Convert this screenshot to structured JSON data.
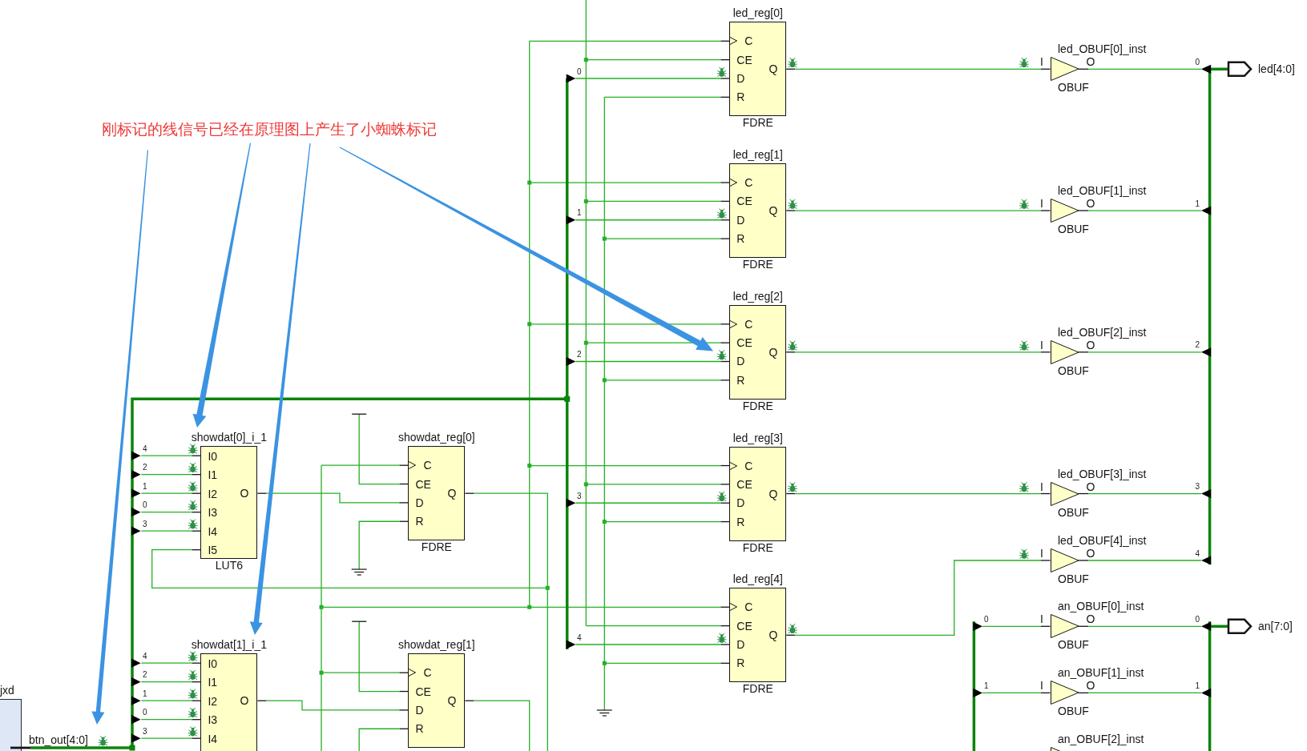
{
  "annotation": {
    "text": "刚标记的线信号已经在原理图上产生了小蜘蛛标记"
  },
  "source_module": {
    "name": "jxd",
    "output": {
      "label": "btn_out[4:0]",
      "debug": true
    }
  },
  "luts": [
    {
      "name": "showdat[0]_i_1",
      "type": "LUT6",
      "inputs": [
        {
          "label": "I0",
          "bit": "4",
          "debug": true
        },
        {
          "label": "I1",
          "bit": "2",
          "debug": true
        },
        {
          "label": "I2",
          "bit": "1",
          "debug": true
        },
        {
          "label": "I3",
          "bit": "0",
          "debug": true
        },
        {
          "label": "I4",
          "bit": "3",
          "debug": true
        },
        {
          "label": "I5",
          "debug": false
        }
      ],
      "output": "O"
    },
    {
      "name": "showdat[1]_i_1",
      "inputs": [
        {
          "label": "I0",
          "bit": "4",
          "debug": true
        },
        {
          "label": "I1",
          "bit": "2",
          "debug": true
        },
        {
          "label": "I2",
          "bit": "1",
          "debug": true
        },
        {
          "label": "I3",
          "bit": "0",
          "debug": true
        },
        {
          "label": "I4",
          "bit": "3",
          "debug": true
        }
      ],
      "output": "O"
    }
  ],
  "showdat_regs": [
    {
      "name": "showdat_reg[0]",
      "type": "FDRE",
      "inputs": [
        "C",
        "CE",
        "D",
        "R"
      ],
      "output": "Q"
    },
    {
      "name": "showdat_reg[1]",
      "inputs": [
        "C",
        "CE",
        "D",
        "R"
      ],
      "output": "Q"
    }
  ],
  "led_regs": [
    {
      "name": "led_reg[0]",
      "type": "FDRE",
      "bit": "0",
      "inputs": [
        {
          "label": "C",
          "debug": false
        },
        {
          "label": "CE",
          "debug": false
        },
        {
          "label": "D",
          "debug": true
        },
        {
          "label": "R",
          "debug": false
        }
      ],
      "output": {
        "label": "Q",
        "debug": true
      }
    },
    {
      "name": "led_reg[1]",
      "type": "FDRE",
      "bit": "1",
      "inputs": [
        {
          "label": "C",
          "debug": false
        },
        {
          "label": "CE",
          "debug": false
        },
        {
          "label": "D",
          "debug": true
        },
        {
          "label": "R",
          "debug": false
        }
      ],
      "output": {
        "label": "Q",
        "debug": true
      }
    },
    {
      "name": "led_reg[2]",
      "type": "FDRE",
      "bit": "2",
      "inputs": [
        {
          "label": "C",
          "debug": false
        },
        {
          "label": "CE",
          "debug": false
        },
        {
          "label": "D",
          "debug": true
        },
        {
          "label": "R",
          "debug": false
        }
      ],
      "output": {
        "label": "Q",
        "debug": true
      }
    },
    {
      "name": "led_reg[3]",
      "type": "FDRE",
      "bit": "3",
      "inputs": [
        {
          "label": "C",
          "debug": false
        },
        {
          "label": "CE",
          "debug": false
        },
        {
          "label": "D",
          "debug": true
        },
        {
          "label": "R",
          "debug": false
        }
      ],
      "output": {
        "label": "Q",
        "debug": true
      }
    },
    {
      "name": "led_reg[4]",
      "type": "FDRE",
      "bit": "4",
      "inputs": [
        {
          "label": "C",
          "debug": false
        },
        {
          "label": "CE",
          "debug": false
        },
        {
          "label": "D",
          "debug": true
        },
        {
          "label": "R",
          "debug": false
        }
      ],
      "output": {
        "label": "Q",
        "debug": true
      }
    }
  ],
  "led_outputs": {
    "port": "led[4:0]",
    "buffers": [
      {
        "name": "led_OBUF[0]_inst",
        "type": "OBUF",
        "input": "I",
        "output": "O",
        "debug": true,
        "out_bit": "0"
      },
      {
        "name": "led_OBUF[1]_inst",
        "type": "OBUF",
        "input": "I",
        "output": "O",
        "debug": true,
        "out_bit": "1"
      },
      {
        "name": "led_OBUF[2]_inst",
        "type": "OBUF",
        "input": "I",
        "output": "O",
        "debug": true,
        "out_bit": "2"
      },
      {
        "name": "led_OBUF[3]_inst",
        "type": "OBUF",
        "input": "I",
        "output": "O",
        "debug": true,
        "out_bit": "3"
      },
      {
        "name": "led_OBUF[4]_inst",
        "type": "OBUF",
        "input": "I",
        "output": "O",
        "debug": true,
        "out_bit": "4"
      }
    ]
  },
  "an_outputs": {
    "port": "an[7:0]",
    "buffers": [
      {
        "name": "an_OBUF[0]_inst",
        "type": "OBUF",
        "input": "I",
        "output": "O",
        "debug": false,
        "in_bit": "0",
        "out_bit": "0"
      },
      {
        "name": "an_OBUF[1]_inst",
        "type": "OBUF",
        "input": "I",
        "output": "O",
        "debug": false,
        "in_bit": "1",
        "out_bit": "1"
      },
      {
        "name": "an_OBUF[2]_inst",
        "debug": false
      }
    ]
  }
}
